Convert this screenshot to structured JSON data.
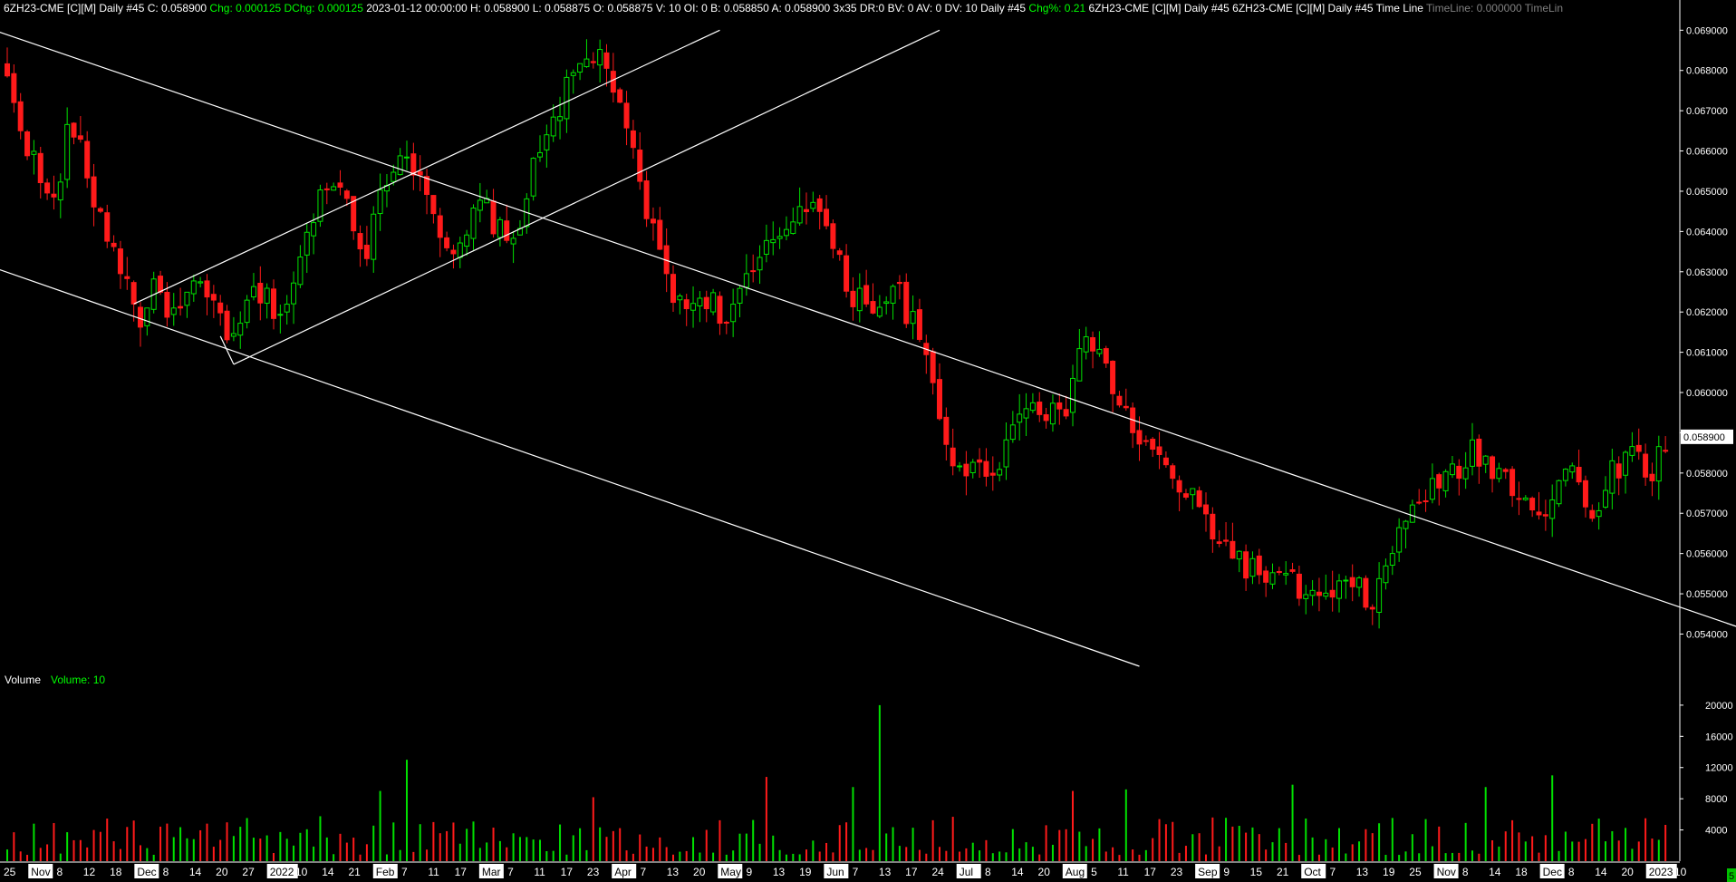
{
  "header": {
    "segments": [
      {
        "text": "6ZH23-CME [C][M]  Daily  #45 C: 0.058900",
        "color": "#ffffff"
      },
      {
        "text": " Chg: 0.000125 DChg: 0.000125",
        "color": "#00ff00"
      },
      {
        "text": " 2023-01-12 00:00:00 H: 0.058900  L: 0.058875  O: 0.058875  V: 10  OI: 0  B: 0.058850  A: 0.058900  3x35  DR:0  BV: 0  AV: 0  DV: 10  Daily #45",
        "color": "#ffffff"
      },
      {
        "text": " Chg%: 0.21",
        "color": "#00ff00"
      },
      {
        "text": "  6ZH23-CME [C][M]  Daily  #45 6ZH23-CME [C][M]  Daily  #45 Time Line",
        "color": "#ffffff"
      },
      {
        "text": "  TimeLine: 0.000000  TimeLin",
        "color": "#808080"
      }
    ]
  },
  "volume_header": {
    "label": "Volume",
    "value": "Volume: 10"
  },
  "corner_badge": "5",
  "colors": {
    "up": "#00e000",
    "down": "#ff1a1a",
    "line": "#ffffff",
    "bg": "#000000"
  },
  "chart_data": {
    "type": "candlestick",
    "symbol": "6ZH23-CME",
    "interval": "Daily",
    "price_axis": {
      "ticks": [
        "0.069000",
        "0.068000",
        "0.067000",
        "0.066000",
        "0.065000",
        "0.064000",
        "0.063000",
        "0.062000",
        "0.061000",
        "0.060000",
        "0.059000",
        "0.058000",
        "0.057000",
        "0.056000",
        "0.055000",
        "0.054000"
      ],
      "range": [
        0.0532,
        0.0693
      ],
      "last_price": "0.058900"
    },
    "volume_axis": {
      "ticks": [
        "20000",
        "16000",
        "12000",
        "8000",
        "4000"
      ],
      "range": [
        0,
        21500
      ]
    },
    "date_labels": [
      {
        "text": "25",
        "boxed": false
      },
      {
        "text": "Nov",
        "boxed": true
      },
      {
        "text": "8",
        "boxed": false
      },
      {
        "text": "12",
        "boxed": false
      },
      {
        "text": "18",
        "boxed": false
      },
      {
        "text": "Dec",
        "boxed": true
      },
      {
        "text": "8",
        "boxed": false
      },
      {
        "text": "14",
        "boxed": false
      },
      {
        "text": "20",
        "boxed": false
      },
      {
        "text": "27",
        "boxed": false
      },
      {
        "text": "2022",
        "boxed": true
      },
      {
        "text": "10",
        "boxed": false
      },
      {
        "text": "14",
        "boxed": false
      },
      {
        "text": "21",
        "boxed": false
      },
      {
        "text": "Feb",
        "boxed": true
      },
      {
        "text": "7",
        "boxed": false
      },
      {
        "text": "11",
        "boxed": false
      },
      {
        "text": "17",
        "boxed": false
      },
      {
        "text": "Mar",
        "boxed": true
      },
      {
        "text": "7",
        "boxed": false
      },
      {
        "text": "11",
        "boxed": false
      },
      {
        "text": "17",
        "boxed": false
      },
      {
        "text": "23",
        "boxed": false
      },
      {
        "text": "Apr",
        "boxed": true
      },
      {
        "text": "7",
        "boxed": false
      },
      {
        "text": "13",
        "boxed": false
      },
      {
        "text": "20",
        "boxed": false
      },
      {
        "text": "May",
        "boxed": true
      },
      {
        "text": "9",
        "boxed": false
      },
      {
        "text": "13",
        "boxed": false
      },
      {
        "text": "19",
        "boxed": false
      },
      {
        "text": "Jun",
        "boxed": true
      },
      {
        "text": "7",
        "boxed": false
      },
      {
        "text": "13",
        "boxed": false
      },
      {
        "text": "17",
        "boxed": false
      },
      {
        "text": "24",
        "boxed": false
      },
      {
        "text": "Jul",
        "boxed": true
      },
      {
        "text": "8",
        "boxed": false
      },
      {
        "text": "14",
        "boxed": false
      },
      {
        "text": "20",
        "boxed": false
      },
      {
        "text": "Aug",
        "boxed": true
      },
      {
        "text": "5",
        "boxed": false
      },
      {
        "text": "11",
        "boxed": false
      },
      {
        "text": "17",
        "boxed": false
      },
      {
        "text": "23",
        "boxed": false
      },
      {
        "text": "Sep",
        "boxed": true
      },
      {
        "text": "9",
        "boxed": false
      },
      {
        "text": "15",
        "boxed": false
      },
      {
        "text": "21",
        "boxed": false
      },
      {
        "text": "Oct",
        "boxed": true
      },
      {
        "text": "7",
        "boxed": false
      },
      {
        "text": "13",
        "boxed": false
      },
      {
        "text": "19",
        "boxed": false
      },
      {
        "text": "25",
        "boxed": false
      },
      {
        "text": "Nov",
        "boxed": true
      },
      {
        "text": "8",
        "boxed": false
      },
      {
        "text": "14",
        "boxed": false
      },
      {
        "text": "18",
        "boxed": false
      },
      {
        "text": "Dec",
        "boxed": true
      },
      {
        "text": "8",
        "boxed": false
      },
      {
        "text": "14",
        "boxed": false
      },
      {
        "text": "20",
        "boxed": false
      },
      {
        "text": "2023",
        "boxed": true
      },
      {
        "text": "10",
        "boxed": false
      }
    ],
    "price_path": [
      [
        0,
        0.0677
      ],
      [
        10,
        0.066
      ],
      [
        20,
        0.0645
      ],
      [
        28,
        0.0668
      ],
      [
        40,
        0.0645
      ],
      [
        50,
        0.0632
      ],
      [
        58,
        0.0618
      ],
      [
        66,
        0.0626
      ],
      [
        75,
        0.0618
      ],
      [
        82,
        0.0626
      ],
      [
        94,
        0.062
      ],
      [
        100,
        0.0611
      ],
      [
        108,
        0.0625
      ],
      [
        122,
        0.062
      ],
      [
        130,
        0.0633
      ],
      [
        142,
        0.0655
      ],
      [
        150,
        0.0648
      ],
      [
        158,
        0.0635
      ],
      [
        172,
        0.066
      ],
      [
        184,
        0.0655
      ],
      [
        196,
        0.063
      ],
      [
        210,
        0.0648
      ],
      [
        222,
        0.0635
      ],
      [
        238,
        0.0665
      ],
      [
        252,
        0.068
      ],
      [
        264,
        0.0685
      ],
      [
        270,
        0.067
      ],
      [
        276,
        0.066
      ],
      [
        285,
        0.064
      ],
      [
        298,
        0.062
      ],
      [
        308,
        0.0625
      ],
      [
        318,
        0.0618
      ],
      [
        330,
        0.063
      ],
      [
        342,
        0.064
      ],
      [
        356,
        0.065
      ],
      [
        362,
        0.064
      ],
      [
        372,
        0.0625
      ],
      [
        384,
        0.0622
      ],
      [
        394,
        0.0625
      ],
      [
        404,
        0.0612
      ],
      [
        416,
        0.0585
      ],
      [
        428,
        0.058
      ],
      [
        438,
        0.0583
      ],
      [
        452,
        0.06
      ],
      [
        466,
        0.0592
      ],
      [
        476,
        0.0615
      ],
      [
        486,
        0.0605
      ],
      [
        496,
        0.0592
      ],
      [
        506,
        0.0585
      ],
      [
        516,
        0.0578
      ],
      [
        528,
        0.057
      ],
      [
        538,
        0.0562
      ],
      [
        552,
        0.0555
      ],
      [
        566,
        0.0553
      ],
      [
        580,
        0.0548
      ],
      [
        594,
        0.0552
      ],
      [
        604,
        0.0548
      ],
      [
        612,
        0.056
      ],
      [
        622,
        0.0573
      ],
      [
        636,
        0.0578
      ],
      [
        648,
        0.0585
      ],
      [
        660,
        0.058
      ],
      [
        670,
        0.0575
      ],
      [
        680,
        0.057
      ],
      [
        690,
        0.0583
      ],
      [
        700,
        0.0568
      ],
      [
        708,
        0.058
      ],
      [
        718,
        0.0585
      ],
      [
        728,
        0.058
      ],
      [
        733,
        0.0589
      ]
    ],
    "volume_spikes": [
      {
        "bar": 60,
        "value": 13000,
        "dir": "up"
      },
      {
        "bar": 56,
        "value": 9000,
        "dir": "up"
      },
      {
        "bar": 88,
        "value": 8200,
        "dir": "down"
      },
      {
        "bar": 114,
        "value": 10800,
        "dir": "down"
      },
      {
        "bar": 127,
        "value": 9500,
        "dir": "up"
      },
      {
        "bar": 131,
        "value": 20000,
        "dir": "up"
      },
      {
        "bar": 160,
        "value": 9000,
        "dir": "down"
      },
      {
        "bar": 168,
        "value": 9200,
        "dir": "up"
      },
      {
        "bar": 193,
        "value": 9800,
        "dir": "up"
      },
      {
        "bar": 222,
        "value": 9500,
        "dir": "up"
      },
      {
        "bar": 232,
        "value": 11000,
        "dir": "up"
      },
      {
        "bar": 258,
        "value": 17000,
        "dir": "down"
      },
      {
        "bar": 265,
        "value": 8000,
        "dir": "down"
      }
    ],
    "trendlines": [
      {
        "name": "downtrend-upper",
        "from": {
          "bar": -2,
          "price": 0.069
        },
        "to": {
          "bar": 278,
          "price": 0.05315
        }
      },
      {
        "name": "downtrend-lower",
        "from": {
          "bar": -2,
          "price": 0.0631
        },
        "to": {
          "bar": 170,
          "price": 0.0532
        }
      },
      {
        "name": "channel-upper",
        "from": {
          "bar": 19,
          "price": 0.0622
        },
        "to": {
          "bar": 107,
          "price": 0.069
        }
      },
      {
        "name": "channel-lower",
        "from": {
          "bar": 34,
          "price": 0.0607
        },
        "to": {
          "bar": 140,
          "price": 0.069
        }
      },
      {
        "name": "channel-base",
        "from": {
          "bar": 34,
          "price": 0.0607
        },
        "to": {
          "bar": 32,
          "price": 0.0614
        }
      }
    ]
  }
}
